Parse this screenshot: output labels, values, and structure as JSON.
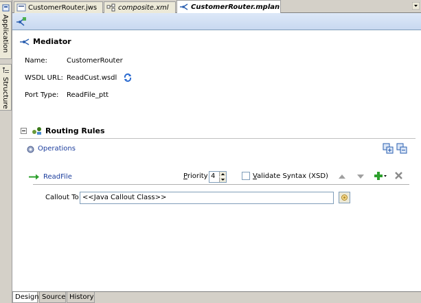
{
  "left_rail": {
    "tabs": [
      {
        "label": "Application"
      },
      {
        "label": "Structure"
      }
    ]
  },
  "tabs": [
    {
      "label": "CustomerRouter.jws",
      "active": false
    },
    {
      "label": "composite.xml",
      "active": false
    },
    {
      "label": "CustomerRouter.mplan",
      "active": true
    }
  ],
  "mediator": {
    "title": "Mediator",
    "name_label": "Name:",
    "name_value": "CustomerRouter",
    "wsdl_label": "WSDL URL:",
    "wsdl_value": "ReadCust.wsdl",
    "port_type_label": "Port Type:",
    "port_type_value": "ReadFile_ptt"
  },
  "routing": {
    "title": "Routing Rules",
    "operations_label": "Operations",
    "operation": {
      "name": "ReadFile",
      "priority_label_prefix": "",
      "priority_label_accel": "P",
      "priority_label_rest": "riority",
      "priority_value": "4",
      "validate_accel": "V",
      "validate_rest": "alidate Syntax (XSD)",
      "validate_checked": false
    },
    "callout_label": "Callout To",
    "callout_value": "<<Java Callout Class>>"
  },
  "bottom_tabs": [
    {
      "label": "Design",
      "active": true
    },
    {
      "label": "Source",
      "active": false
    },
    {
      "label": "History",
      "active": false
    }
  ],
  "colors": {
    "link": "#1a3c9c",
    "toolbar": "#c8d8f0",
    "add_green": "#2ea02e"
  }
}
